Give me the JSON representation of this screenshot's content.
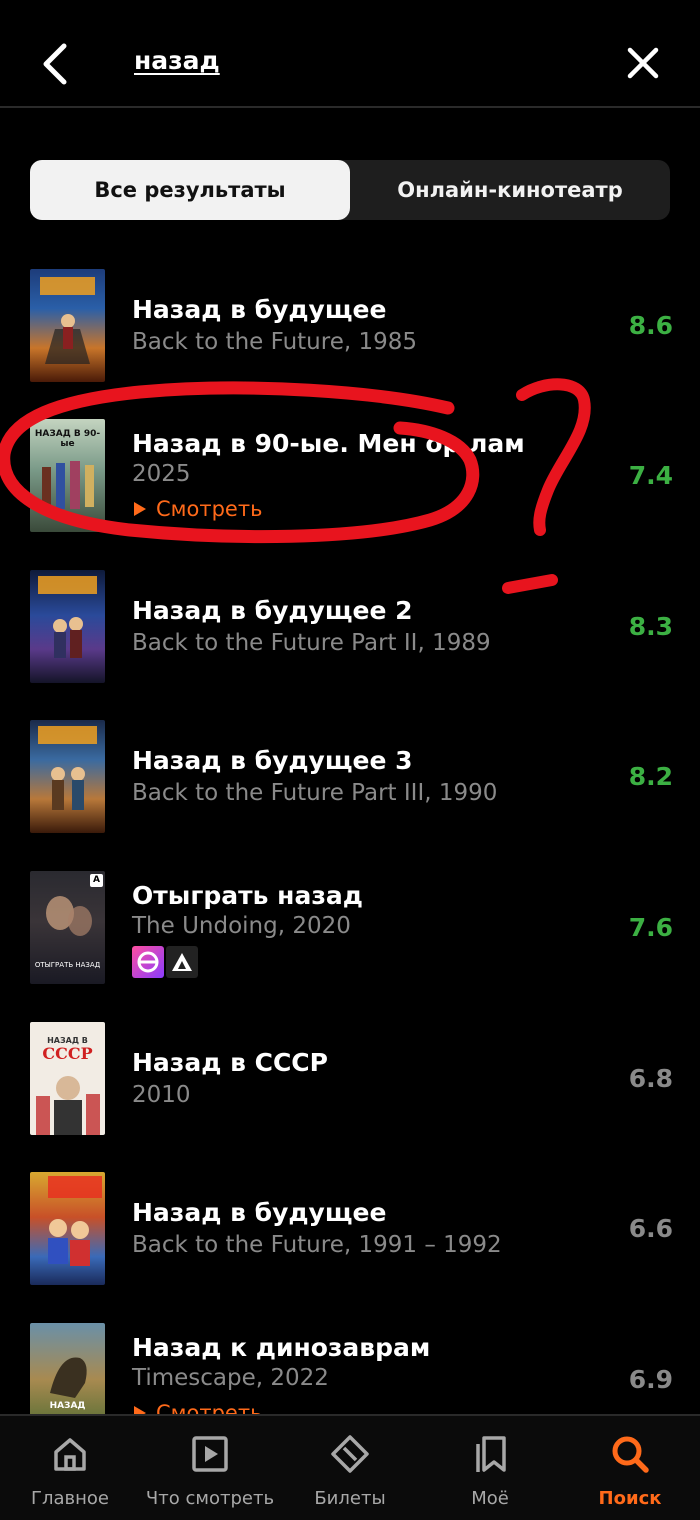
{
  "search": {
    "query": "назад"
  },
  "tabs": [
    {
      "label": "Все результаты",
      "active": true
    },
    {
      "label": "Онлайн-кинотеатр",
      "active": false
    }
  ],
  "results": [
    {
      "title": "Назад в будущее",
      "subtitle": "Back to the Future, 1985",
      "rating": "8.6",
      "rating_color": "#3cb043"
    },
    {
      "title": "Назад в 90-ые. Мен ор  лам",
      "subtitle": "2025",
      "rating": "7.4",
      "rating_color": "#3cb043",
      "action": "Смотреть",
      "poster_text": "НАЗАД В 90-ые"
    },
    {
      "title": "Назад в будущее 2",
      "subtitle": "Back to the Future Part II, 1989",
      "rating": "8.3",
      "rating_color": "#3cb043"
    },
    {
      "title": "Назад в будущее 3",
      "subtitle": "Back to the Future Part III, 1990",
      "rating": "8.2",
      "rating_color": "#3cb043"
    },
    {
      "title": "Отыграть назад",
      "subtitle": "The Undoing, 2020",
      "rating": "7.6",
      "rating_color": "#3cb043",
      "poster_text": "ОТЫГРАТЬ НАЗАД",
      "poster_badge": "A",
      "badges": [
        "plus-icon",
        "amediateka-icon"
      ]
    },
    {
      "title": "Назад в СССР",
      "subtitle": "2010",
      "rating": "6.8",
      "rating_color": "#8a8a8a",
      "poster_text": "НАЗАД В",
      "poster_text_2": "СССР"
    },
    {
      "title": "Назад в будущее",
      "subtitle": "Back to the Future, 1991 – 1992",
      "rating": "6.6",
      "rating_color": "#8a8a8a"
    },
    {
      "title": "Назад к динозаврам",
      "subtitle": "Timescape, 2022",
      "rating": "6.9",
      "rating_color": "#8a8a8a",
      "action": "Смотреть",
      "poster_text": "НАЗАД"
    }
  ],
  "nav": [
    {
      "label": "Главное",
      "icon": "home-icon"
    },
    {
      "label": "Что смотреть",
      "icon": "play-icon"
    },
    {
      "label": "Билеты",
      "icon": "ticket-icon"
    },
    {
      "label": "Моё",
      "icon": "bookmarks-icon"
    },
    {
      "label": "Поиск",
      "icon": "search-icon",
      "active": true
    }
  ],
  "colors": {
    "accent": "#ff6a1a",
    "rating_high": "#3cb043",
    "rating_mid": "#8a8a8a",
    "annotation": "#e8141e"
  }
}
